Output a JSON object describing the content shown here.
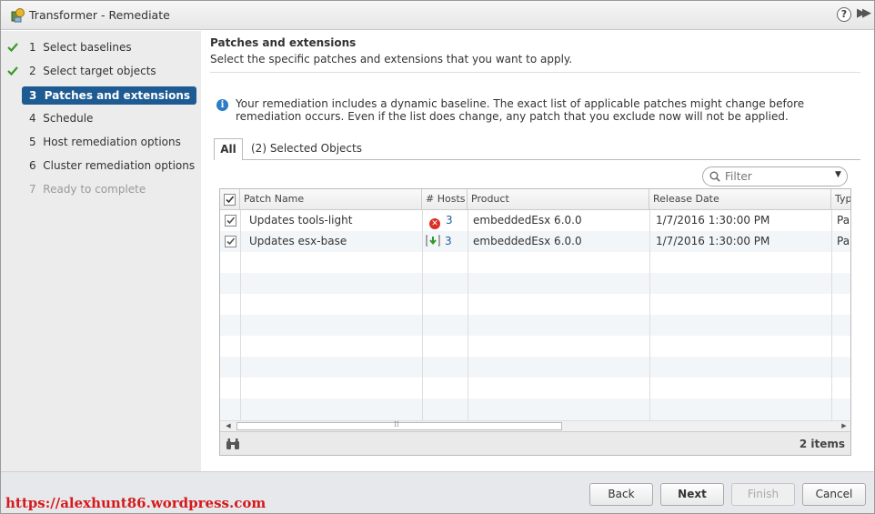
{
  "window": {
    "title": "Transformer - Remediate",
    "help_glyph": "?",
    "expand_glyph": "▶▶"
  },
  "steps": [
    {
      "num": "1",
      "label": "Select baselines",
      "state": "done"
    },
    {
      "num": "2",
      "label": "Select target objects",
      "state": "done"
    },
    {
      "num": "3",
      "label": "Patches and extensions",
      "state": "active"
    },
    {
      "num": "4",
      "label": "Schedule",
      "state": "pending"
    },
    {
      "num": "5",
      "label": "Host remediation options",
      "state": "pending"
    },
    {
      "num": "6",
      "label": "Cluster remediation options",
      "state": "pending"
    },
    {
      "num": "7",
      "label": "Ready to complete",
      "state": "disabled"
    }
  ],
  "main": {
    "title": "Patches and extensions",
    "description": "Select the specific patches and extensions that you want to apply.",
    "info_glyph": "i",
    "info_text": "Your remediation includes a dynamic baseline. The exact list of applicable patches might change before remediation occurs. Even if the list does change, any patch that you exclude now will not be applied."
  },
  "tabs": [
    {
      "label": "All",
      "active": true
    },
    {
      "label": "(2) Selected Objects",
      "active": false
    }
  ],
  "filter": {
    "placeholder": "Filter",
    "value": ""
  },
  "table": {
    "columns": [
      "Patch Name",
      "# Hosts",
      "Product",
      "Release Date",
      "Typ"
    ],
    "rows": [
      {
        "checked": true,
        "name": "Updates tools-light",
        "hosts_icon": "error-icon",
        "hosts_glyph": "✕",
        "hosts": "3",
        "product": "embeddedEsx 6.0.0",
        "release_date": "1/7/2016 1:30:00 PM",
        "type": "Pa"
      },
      {
        "checked": true,
        "name": "Updates esx-base",
        "hosts_icon": "staged-download-icon",
        "hosts": "3",
        "product": "embeddedEsx 6.0.0",
        "release_date": "1/7/2016 1:30:00 PM",
        "type": "Pa"
      }
    ],
    "scroll_left_glyph": "◀",
    "scroll_right_glyph": "▶",
    "scroll_grip": "⁞⁞",
    "item_count": "2 items"
  },
  "buttons": {
    "back": "Back",
    "next": "Next",
    "finish": "Finish",
    "cancel": "Cancel"
  },
  "watermark": "https://alexhunt86.wordpress.com",
  "colors": {
    "active_step": "#1e5b93",
    "check_green": "#3a9a28",
    "link_blue": "#1a5c9e",
    "error_red": "#d93025",
    "watermark_red": "#d41a1a"
  }
}
